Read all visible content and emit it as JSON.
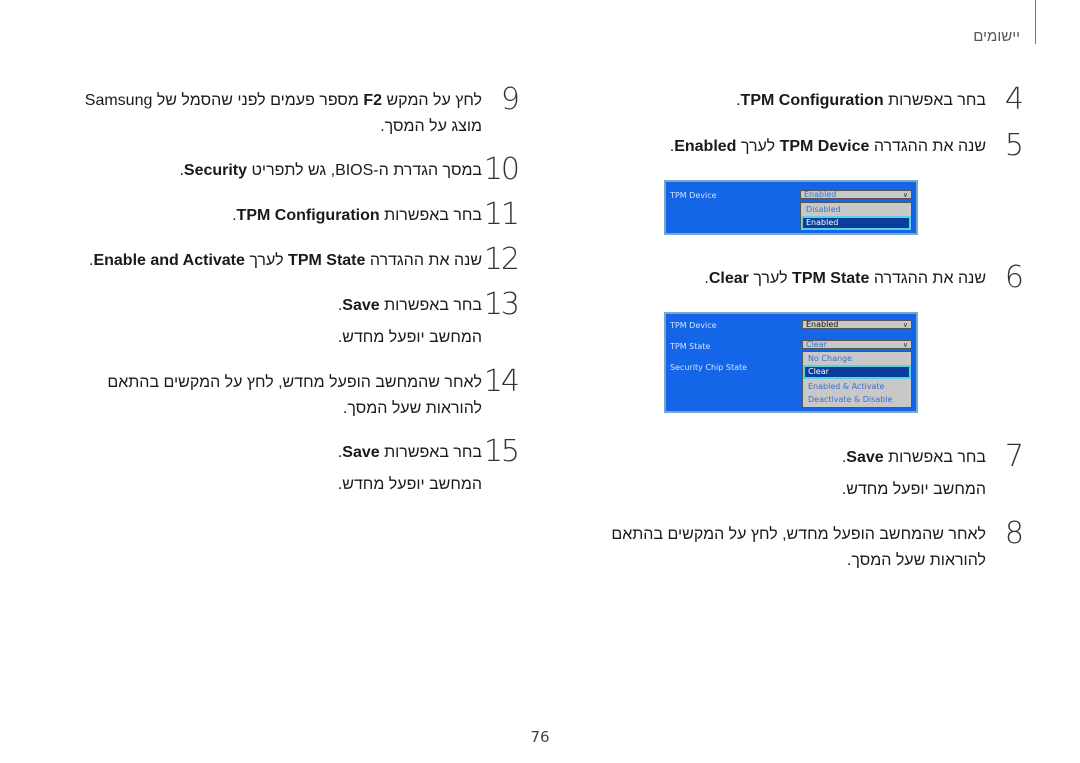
{
  "header": {
    "section_title": "יישומים"
  },
  "page_number": "76",
  "steps": {
    "s4": {
      "num": "4",
      "pre": "בחר באפשרות ",
      "bold": "TPM Configuration",
      "post": "."
    },
    "s5": {
      "num": "5",
      "pre": "שנה את ההגדרה ",
      "bold": "TPM Device",
      "mid": " לערך ",
      "bold2": "Enabled",
      "post": "."
    },
    "s6": {
      "num": "6",
      "pre": "שנה את ההגדרה ",
      "bold": "TPM State",
      "mid": " לערך ",
      "bold2": "Clear",
      "post": "."
    },
    "s7": {
      "num": "7",
      "pre": "בחר באפשרות ",
      "bold": "Save",
      "post": ".",
      "sub": "המחשב יופעל מחדש."
    },
    "s8": {
      "num": "8",
      "line1": "לאחר שהמחשב הופעל מחדש, לחץ על המקשים בהתאם",
      "line2": "להוראות שעל המסך."
    },
    "s9": {
      "num": "9",
      "pre": "לחץ על המקש ",
      "bold": "F2",
      "mid": " מספר פעמים לפני שהסמל של Samsung",
      "line2": "מוצג על המסך."
    },
    "s10": {
      "num": "10",
      "pre": "במסך הגדרת ה-BIOS, גש לתפריט ",
      "bold": "Security",
      "post": "."
    },
    "s11": {
      "num": "11",
      "pre": "בחר באפשרות ",
      "bold": "TPM Configuration",
      "post": "."
    },
    "s12": {
      "num": "12",
      "pre": "שנה את ההגדרה ",
      "bold": "TPM State",
      "mid": " לערך ",
      "bold2": "Enable and Activate",
      "post": "."
    },
    "s13": {
      "num": "13",
      "pre": "בחר באפשרות ",
      "bold": "Save",
      "post": ".",
      "sub": "המחשב יופעל מחדש."
    },
    "s14": {
      "num": "14",
      "line1": "לאחר שהמחשב הופעל מחדש, לחץ על המקשים בהתאם",
      "line2": "להוראות שעל המסך."
    },
    "s15": {
      "num": "15",
      "pre": "בחר באפשרות ",
      "bold": "Save",
      "post": ".",
      "sub": "המחשב יופעל מחדש."
    }
  },
  "bios1": {
    "label": "TPM Device",
    "selected": "Enabled",
    "chevron": "chevron-down-icon",
    "options": [
      "Disabled",
      "Enabled"
    ],
    "highlighted": "Enabled"
  },
  "bios2": {
    "labels": [
      "TPM Device",
      "TPM State",
      "Security Chip State"
    ],
    "device_value": "Enabled",
    "state_value": "Clear",
    "chevron": "chevron-down-icon",
    "options": [
      "No Change",
      "Clear",
      "Enabled & Activate",
      "Deactivate & Disable"
    ],
    "highlighted": "Clear"
  }
}
